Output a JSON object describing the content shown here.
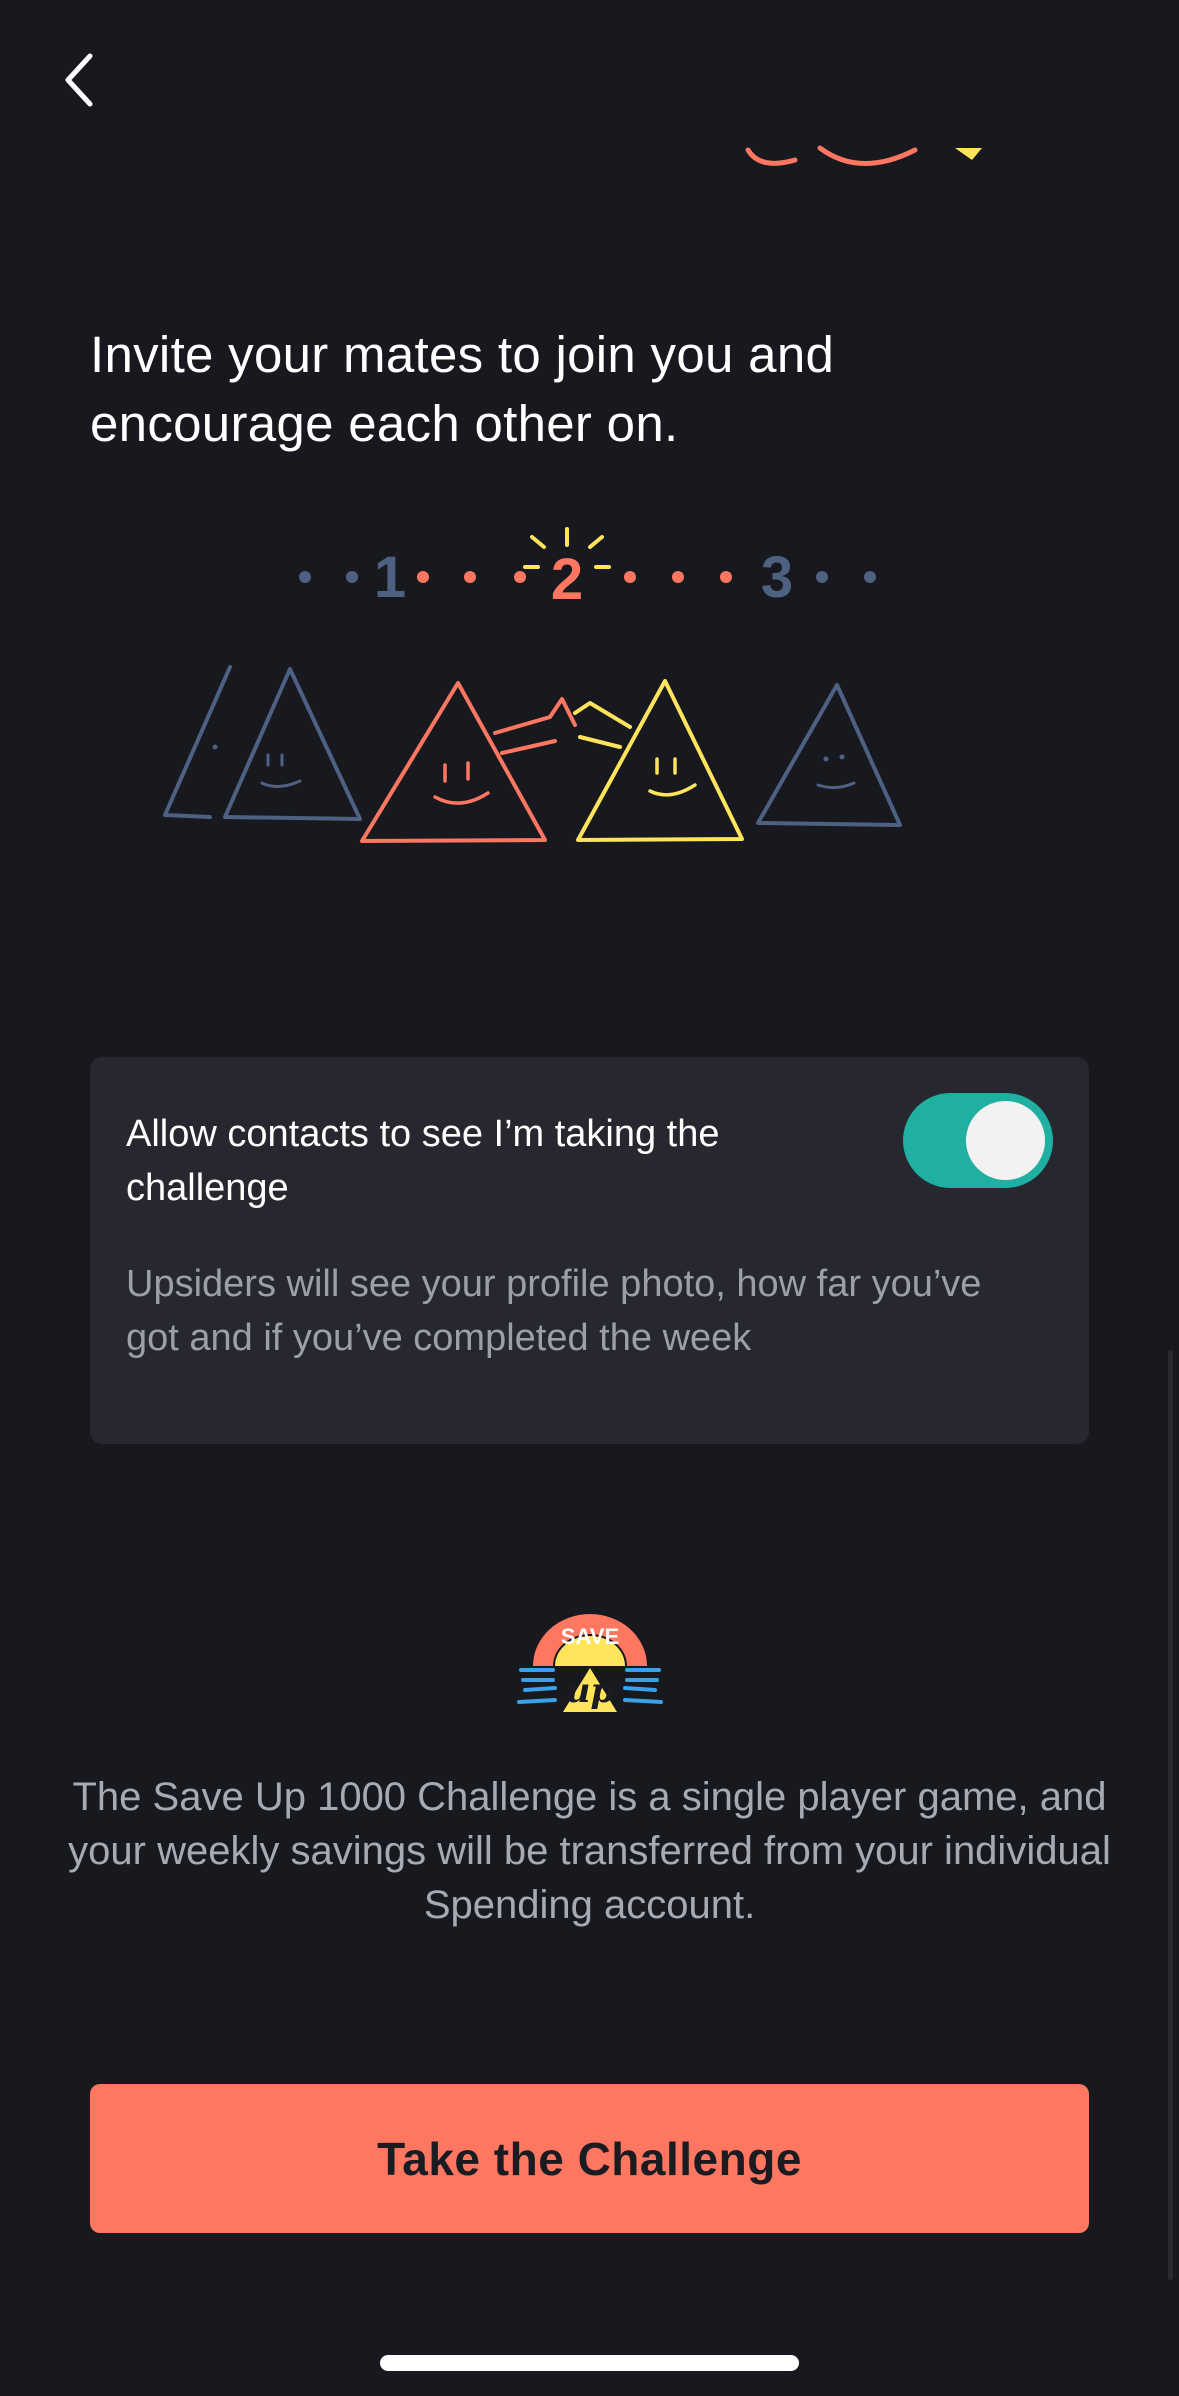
{
  "header": {
    "back_icon": "chevron-left-icon"
  },
  "intro": {
    "text": "Invite your mates to join you and encourage each other on."
  },
  "steps": [
    "1",
    "2",
    "3"
  ],
  "privacy_card": {
    "title": "Allow contacts to see I’m taking the challenge",
    "description": "Upsiders will see your profile photo, how far you’ve got and if you’ve completed the week",
    "toggle_on": true
  },
  "logo": {
    "top_text": "SAVE",
    "bottom_text": "up"
  },
  "disclaimer": "The Save Up 1000 Challenge is a single player game, and your weekly savings will be transferred from your individual Spending account.",
  "cta": {
    "label": "Take the Challenge"
  },
  "colors": {
    "background": "#18191f",
    "card": "#26272f",
    "accent": "#ff7761",
    "toggle": "#1fb0a2",
    "yellow": "#ffe45c",
    "slate": "#4f6182"
  }
}
